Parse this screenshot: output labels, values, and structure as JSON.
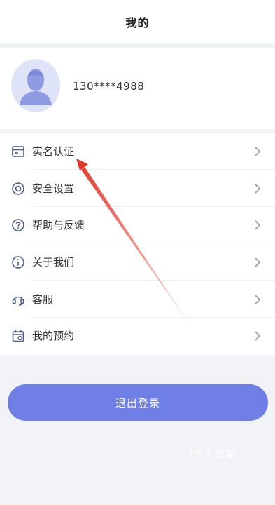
{
  "header": {
    "title": "我的"
  },
  "profile": {
    "phone": "130****4988"
  },
  "menu": {
    "items": [
      {
        "label": "实名认证",
        "icon": "id-card-icon"
      },
      {
        "label": "安全设置",
        "icon": "shield-target-icon"
      },
      {
        "label": "帮助与反馈",
        "icon": "question-icon"
      },
      {
        "label": "关于我们",
        "icon": "info-icon"
      },
      {
        "label": "客服",
        "icon": "headset-icon"
      },
      {
        "label": "我的预约",
        "icon": "calendar-icon"
      }
    ]
  },
  "logout": {
    "label": "退出登录"
  },
  "watermark": {
    "text": "7B下载站"
  },
  "colors": {
    "accent": "#6f7fe6",
    "icon": "#4a5a8c",
    "annotation": "#e0392b"
  }
}
